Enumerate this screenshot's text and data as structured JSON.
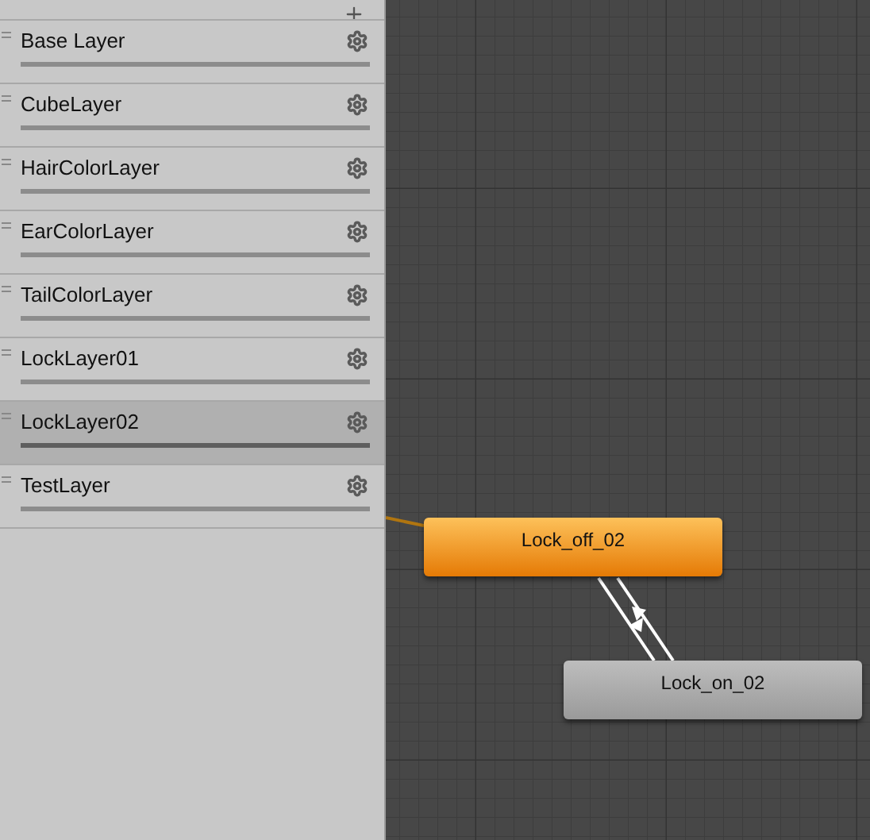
{
  "layers": [
    {
      "name": "Base Layer",
      "selected": false
    },
    {
      "name": "CubeLayer",
      "selected": false
    },
    {
      "name": "HairColorLayer",
      "selected": false
    },
    {
      "name": "EarColorLayer",
      "selected": false
    },
    {
      "name": "TailColorLayer",
      "selected": false
    },
    {
      "name": "LockLayer01",
      "selected": false
    },
    {
      "name": "LockLayer02",
      "selected": true
    },
    {
      "name": "TestLayer",
      "selected": false
    }
  ],
  "states": [
    {
      "name": "Lock_off_02",
      "kind": "default"
    },
    {
      "name": "Lock_on_02",
      "kind": "normal"
    }
  ]
}
